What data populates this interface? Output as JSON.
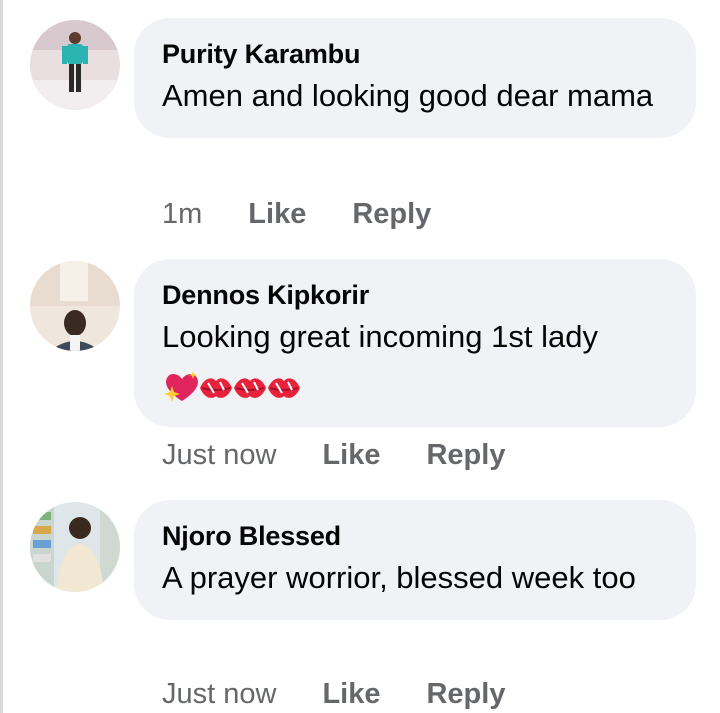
{
  "comments": [
    {
      "name": "Purity Karambu",
      "text": "Amen and looking good dear mama",
      "time": "1m",
      "like_label": "Like",
      "reply_label": "Reply"
    },
    {
      "name": "Dennos Kipkorir",
      "text": "Looking great incoming 1st lady",
      "emojis": [
        "sparkling-heart-emoji",
        "kiss-mark-emoji",
        "kiss-mark-emoji",
        "kiss-mark-emoji"
      ],
      "time": "Just now",
      "like_label": "Like",
      "reply_label": "Reply"
    },
    {
      "name": "Njoro Blessed",
      "text": "A prayer worrior, blessed week too",
      "time": "Just now",
      "like_label": "Like",
      "reply_label": "Reply"
    }
  ],
  "colors": {
    "bubble_bg": "#f0f2f5",
    "name_text": "#050505",
    "meta_text": "#65676b"
  }
}
